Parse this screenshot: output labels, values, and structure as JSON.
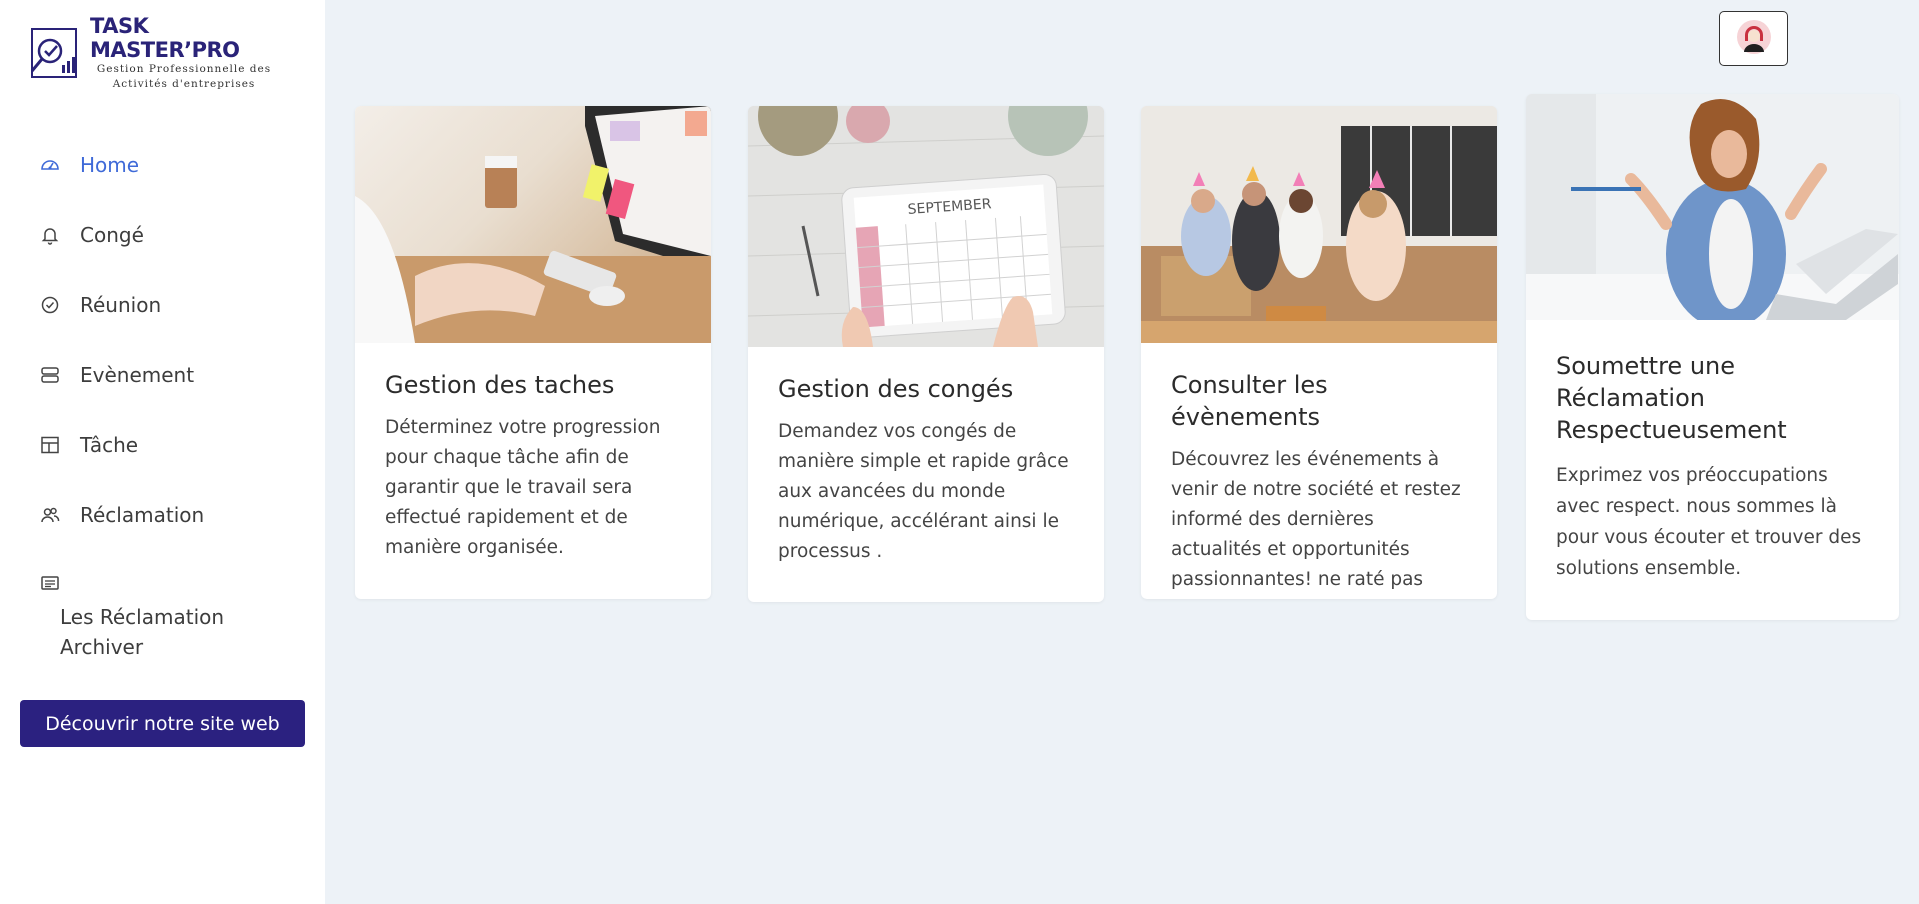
{
  "app": {
    "logo_title": "TASK MASTER’PRO",
    "logo_sub_line1": "Gestion Professionnelle des",
    "logo_sub_line2": "Activités  d'entreprises"
  },
  "sidebar": {
    "items": [
      {
        "label": "Home",
        "icon": "dashboard-icon",
        "active": true
      },
      {
        "label": "Congé",
        "icon": "bell-icon"
      },
      {
        "label": "Réunion",
        "icon": "check-circle-icon"
      },
      {
        "label": "Evènement",
        "icon": "server-icon"
      },
      {
        "label": "Tâche",
        "icon": "layout-icon"
      },
      {
        "label": "Réclamation",
        "icon": "users-icon"
      }
    ],
    "archive_label": "Les Réclamation Archiver",
    "archive_icon": "document-icon",
    "cta_label": "Découvrir notre site web"
  },
  "header": {
    "avatar_icon": "user-avatar-icon"
  },
  "cards": [
    {
      "title": "Gestion des taches",
      "text": "Déterminez votre progression pour chaque tâche afin de garantir que le travail sera effectué rapidement et de manière organisée.",
      "image": "office-typing-image"
    },
    {
      "title": "Gestion des congés",
      "text": "Demandez vos congés de manière simple et rapide grâce aux avancées du monde numérique, accélérant ainsi le processus .",
      "image": "calendar-tablet-image",
      "image_caption": "SEPTEMBER"
    },
    {
      "title": "Consulter les évènements",
      "text": "Découvrez les événements à venir de notre société et restez informé des dernières actualités et opportunités passionnantes! ne raté pas",
      "image": "office-party-image"
    },
    {
      "title": "Soumettre une Réclamation Respectueusement",
      "text": "Exprimez vos préoccupations avec respect. nous sommes là pour vous écouter et trouver des solutions ensemble.",
      "image": "frustrated-woman-laptop-image"
    }
  ],
  "colors": {
    "brand": "#2b2180",
    "active_nav": "#3f6ad8",
    "background": "#edf2f7"
  }
}
